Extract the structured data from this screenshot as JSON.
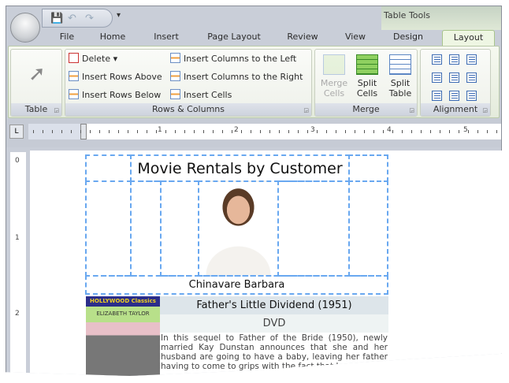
{
  "qat": {
    "save": "💾",
    "undo": "↶",
    "redo": "↷",
    "customize": "▾"
  },
  "context_tab": "Table Tools",
  "tabs": [
    "File",
    "Home",
    "Insert",
    "Page Layout",
    "Review",
    "View",
    "Design",
    "Layout"
  ],
  "active_tab": "Layout",
  "groups": {
    "table": {
      "label": "Table"
    },
    "rows_columns": {
      "label": "Rows & Columns",
      "delete": "Delete ▾",
      "insert_rows_above": "Insert Rows Above",
      "insert_rows_below": "Insert Rows Below",
      "insert_cols_left": "Insert Columns to the Left",
      "insert_cols_right": "Insert Columns to the Right",
      "insert_cells": "Insert Cells"
    },
    "merge": {
      "label": "Merge",
      "merge_cells": [
        "Merge",
        "Cells"
      ],
      "split_cells": [
        "Split",
        "Cells"
      ],
      "split_table": [
        "Split",
        "Table"
      ]
    },
    "alignment": {
      "label": "Alignment"
    }
  },
  "ruler": {
    "corner": "L",
    "numbers": [
      "1",
      "2",
      "3",
      "4",
      "5"
    ],
    "vnumbers": [
      "0",
      "1",
      "2"
    ]
  },
  "document": {
    "title": "Movie Rentals by Customer",
    "customer": "Chinavare Barbara",
    "movie": {
      "title": "Father's Little Dividend (1951)",
      "format": "DVD",
      "poster_text": [
        "HOLLYWOOD Classics",
        "ELIZABETH TAYLOR"
      ],
      "description": "In this sequel to Father of the Bride (1950), newly married Kay Dunstan announces that she and her husband are going to have a baby, leaving her father having to come to grips with the fact that I..."
    }
  }
}
